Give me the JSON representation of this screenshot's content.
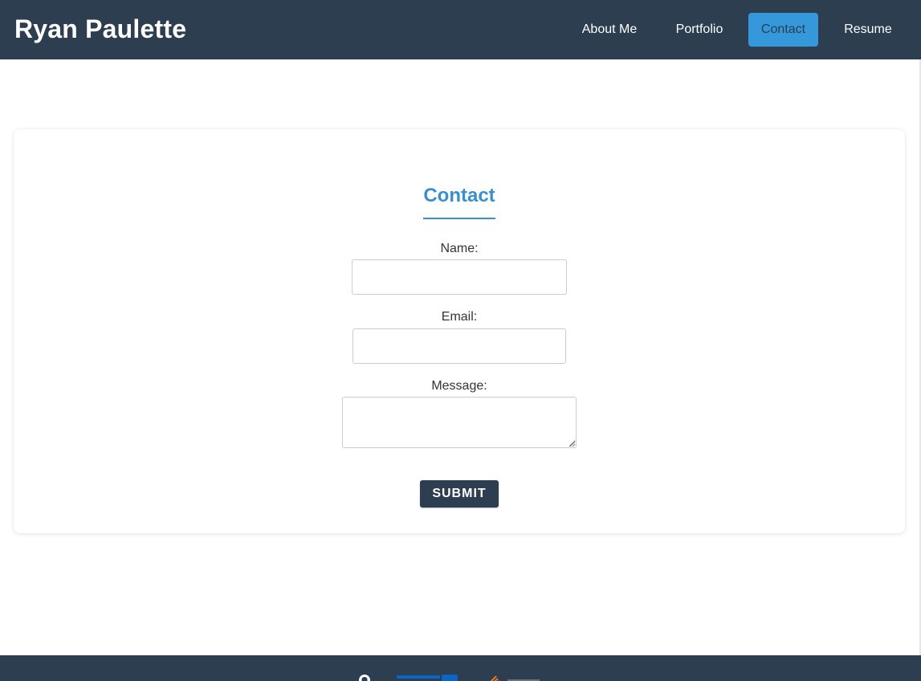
{
  "header": {
    "brand": "Ryan Paulette",
    "nav": [
      {
        "label": "About Me"
      },
      {
        "label": "Portfolio"
      },
      {
        "label": "Contact",
        "active": true
      },
      {
        "label": "Resume"
      }
    ]
  },
  "contact": {
    "title": "Contact",
    "name_label": "Name:",
    "name_value": "",
    "email_label": "Email:",
    "email_value": "",
    "message_label": "Message:",
    "message_value": "",
    "submit_label": "Submit"
  },
  "footer": {
    "links": [
      {
        "icon": "github-icon"
      },
      {
        "icon": "linkedin-icon"
      },
      {
        "icon": "stackoverflow-icon"
      }
    ]
  },
  "colors": {
    "navy": "#2c3e50",
    "accent": "#3498db",
    "title_blue": "#3a8fcf"
  }
}
